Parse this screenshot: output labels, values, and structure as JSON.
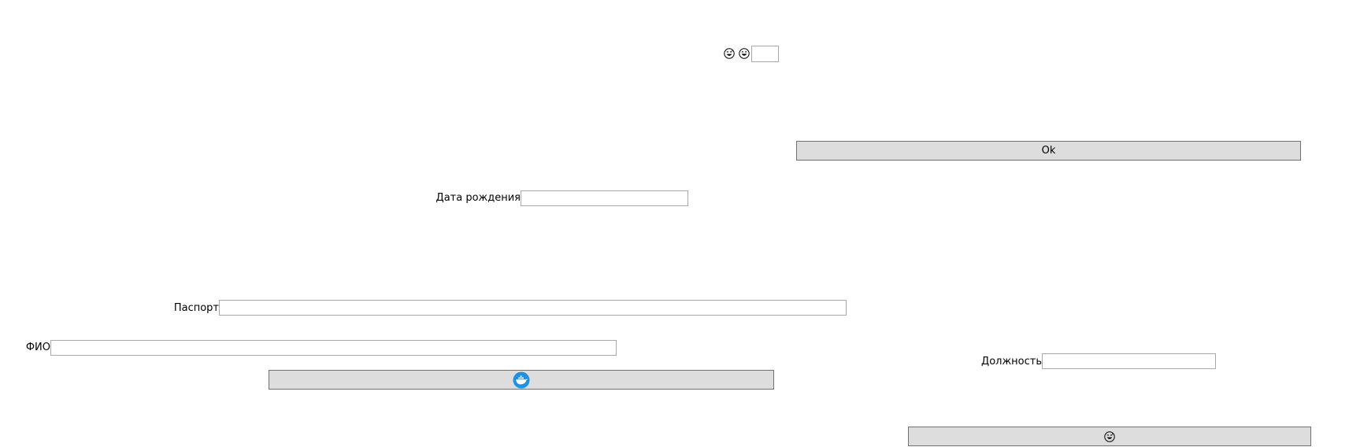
{
  "top": {
    "emoji_left_icon": "grinning-face-with-sweat-icon",
    "emoji_right_icon": "grinning-face-icon",
    "small_input": {
      "value": "",
      "placeholder": ""
    }
  },
  "ok_button": {
    "label": "Ok"
  },
  "birth_date": {
    "label": "Дата рождения",
    "value": "",
    "placeholder": ""
  },
  "passport": {
    "label": "Паспорт",
    "value": "",
    "placeholder": ""
  },
  "full_name": {
    "label": "ФИО",
    "value": "",
    "placeholder": ""
  },
  "position": {
    "label": "Должность",
    "value": "",
    "placeholder": ""
  },
  "docker_button": {
    "icon": "docker-whale-icon"
  },
  "emoji_button": {
    "icon": "grinning-face-with-sweat-icon"
  },
  "colors": {
    "button_bg": "#dddddd",
    "button_border": "#707070",
    "field_border": "#a8a8a8",
    "docker_blue": "#1d91e6"
  }
}
